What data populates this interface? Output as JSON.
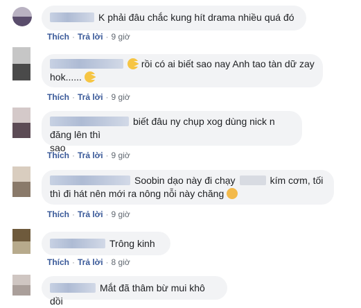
{
  "comments": [
    {
      "text": "K phải đâu chắc kung hít drama nhiều quá đó",
      "like": "Thích",
      "reply": "Trả lời",
      "time": "9 giờ"
    },
    {
      "text1": "rồi có ai biết sao nay Anh tao tàn dữ zay",
      "text2": "hok......",
      "like": "Thích",
      "reply": "Trả lời",
      "time": "9 giờ"
    },
    {
      "text1": "biết đâu ny chụp xog dùng nick n đăng lên thì",
      "text2": "sao",
      "like": "Thích",
      "reply": "Trả lời",
      "time": "9 giờ"
    },
    {
      "text1a": "Soobin dạo này đi chạy",
      "text1b": "kím cơm, tối",
      "text2": "thì đi hát nên mới ra nông nỗi này chăng",
      "like": "Thích",
      "reply": "Trả lời",
      "time": "9 giờ"
    },
    {
      "text": "Trông kinh",
      "like": "Thích",
      "reply": "Trả lời",
      "time": "8 giờ"
    },
    {
      "text": "Mắt đã thâm bừ mui khô dồi"
    }
  ],
  "colors": {
    "bubble": "#f2f3f5",
    "link": "#385898",
    "text": "#1c1e21",
    "meta": "#606770"
  }
}
